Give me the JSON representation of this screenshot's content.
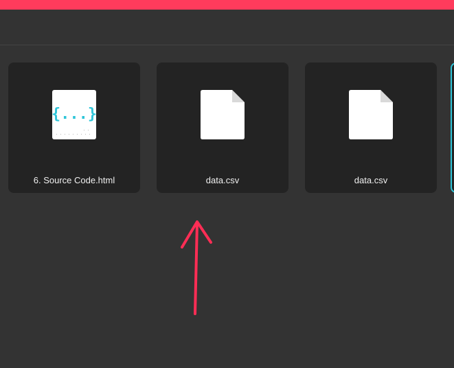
{
  "files": [
    {
      "name": "6. Source Code.html",
      "icon": "code-file-icon"
    },
    {
      "name": "data.csv",
      "icon": "file-icon"
    },
    {
      "name": "data.csv",
      "icon": "file-icon"
    }
  ],
  "colors": {
    "accent_bar": "#ff3b5c",
    "background": "#333333",
    "card": "#232323",
    "selection_border": "#2ec5d9",
    "code_icon": "#2ec5d9",
    "annotation": "#ff2d55"
  }
}
